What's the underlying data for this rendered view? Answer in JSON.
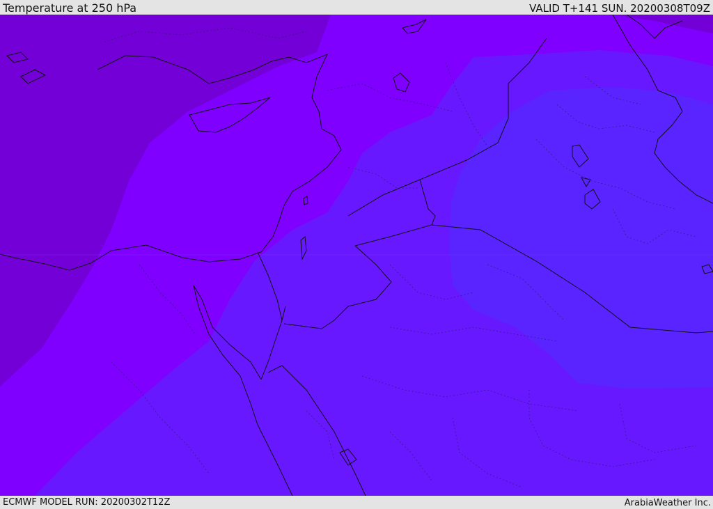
{
  "header": {
    "title": "Temperature at 250 hPa",
    "valid_label": "VALID T+141 SUN. 20200308T09Z"
  },
  "footer": {
    "model_run": "ECMWF MODEL RUN: 20200302T12Z",
    "credit": "ArabiaWeather Inc."
  },
  "map": {
    "colors": {
      "coldest_zone": "#7300d6",
      "cold_zone": "#7f00ff",
      "mid_zone": "#6818ff",
      "warm_zone": "#5924ff",
      "coastline": "#111111",
      "borders": "#1a1a3a"
    }
  }
}
